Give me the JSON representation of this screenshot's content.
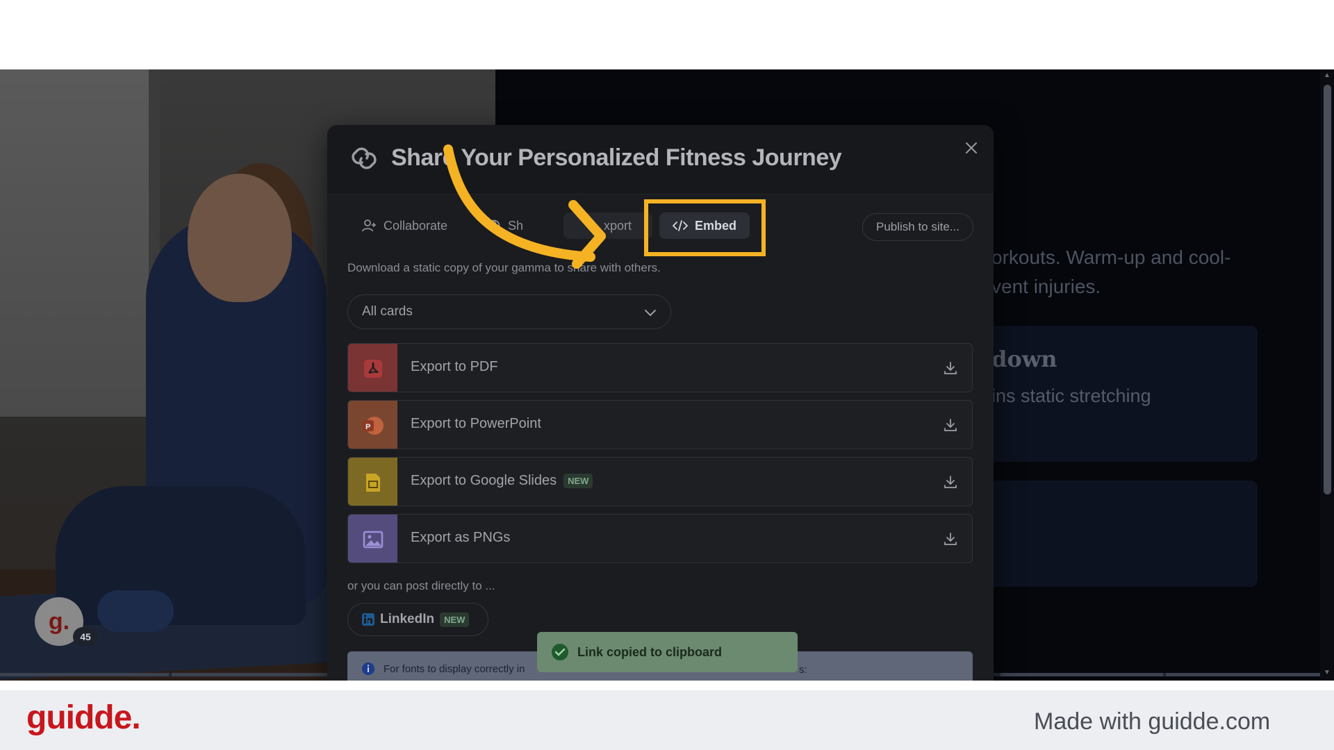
{
  "modal": {
    "title": "Share Your Personalized Fitness Journey",
    "tabs": {
      "collaborate": "Collaborate",
      "share": "Sh",
      "export": "xport",
      "embed": "Embed"
    },
    "publish_button": "Publish to site...",
    "description": "Download a static copy of your gamma to share with others.",
    "select_value": "All cards",
    "export_options": [
      {
        "label": "Export to PDF",
        "icon": "pdf-icon",
        "color": "#a93a3a"
      },
      {
        "label": "Export to PowerPoint",
        "icon": "powerpoint-icon",
        "color": "#a25a3c"
      },
      {
        "label": "Export to Google Slides",
        "icon": "google-slides-icon",
        "color": "#a9902f",
        "badge": "NEW"
      },
      {
        "label": "Export as PNGs",
        "icon": "image-icon",
        "color": "#6a5e9a"
      }
    ],
    "post_label": "or you can post directly to ...",
    "linkedin": {
      "label": "LinkedIn",
      "badge": "NEW"
    },
    "info_text": "For fonts to display correctly in",
    "info_suffix": "s:"
  },
  "toast": {
    "text": "Link copied to clipboard"
  },
  "background": {
    "text_line1": "orkouts. Warm-up and cool-",
    "text_line2": "vent injuries.",
    "card_title": "down",
    "card_text": "ins static stretching"
  },
  "avatar": {
    "letter": "g.",
    "count": "45"
  },
  "footer": {
    "logo": "guidde.",
    "made_with": "Made with guidde.com"
  },
  "colors": {
    "highlight": "#f5b324",
    "brand": "#c8161d"
  }
}
